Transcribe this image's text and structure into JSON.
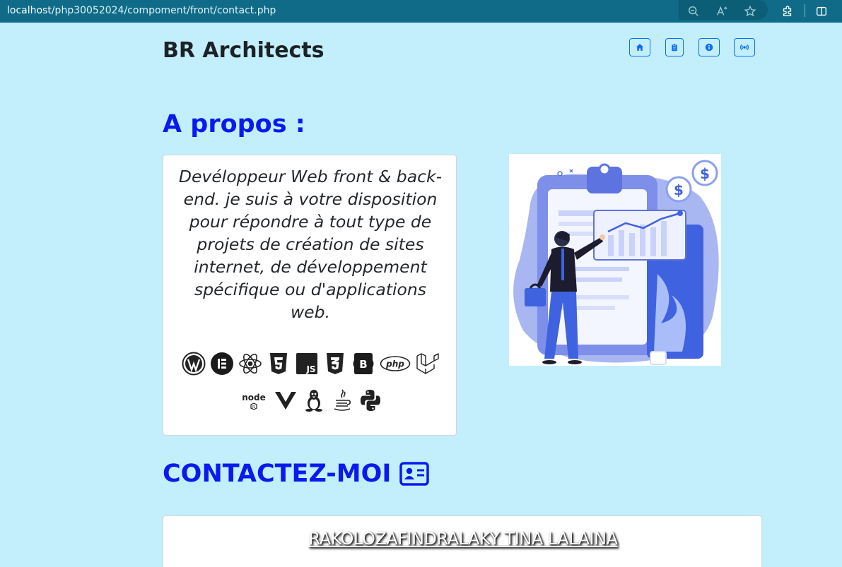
{
  "browser": {
    "url_host": "localhost",
    "url_path": "/php30052024/compoment/front/contact.php",
    "icons": [
      "zoom-out-icon",
      "read-aloud-icon",
      "favorite-star-icon",
      "extensions-icon",
      "split-screen-icon"
    ]
  },
  "header": {
    "brand": "BR Architects",
    "nav": [
      {
        "name": "home-icon"
      },
      {
        "name": "clipboard-icon"
      },
      {
        "name": "info-icon"
      },
      {
        "name": "broadcast-icon"
      }
    ]
  },
  "about": {
    "title": "A propos :",
    "description": "Devéloppeur Web front & back-end. je suis à votre disposition pour répondre à tout type de projets de création de sites internet, de développement spécifique ou d'applications web.",
    "tech_row1": [
      "wordpress-icon",
      "elementor-icon",
      "react-icon",
      "html5-icon",
      "javascript-icon",
      "css3-icon",
      "bootstrap-icon",
      "php-icon",
      "laravel-icon"
    ],
    "tech_row2": [
      "nodejs-icon",
      "vue-icon",
      "linux-icon",
      "java-icon",
      "python-icon"
    ],
    "tech_labels": {
      "javascript": "JS",
      "bootstrap": "B",
      "php": "php",
      "node": "node"
    }
  },
  "contact": {
    "title": "CONTACTEZ-MOI",
    "name": "RAKOLOZAFINDRALAKY TINA LALAINA"
  },
  "colors": {
    "page_bg": "#c2effb",
    "accent_blue": "#0a1aef",
    "nav_blue": "#0d6efd",
    "addressbar": "#0f6b87"
  }
}
